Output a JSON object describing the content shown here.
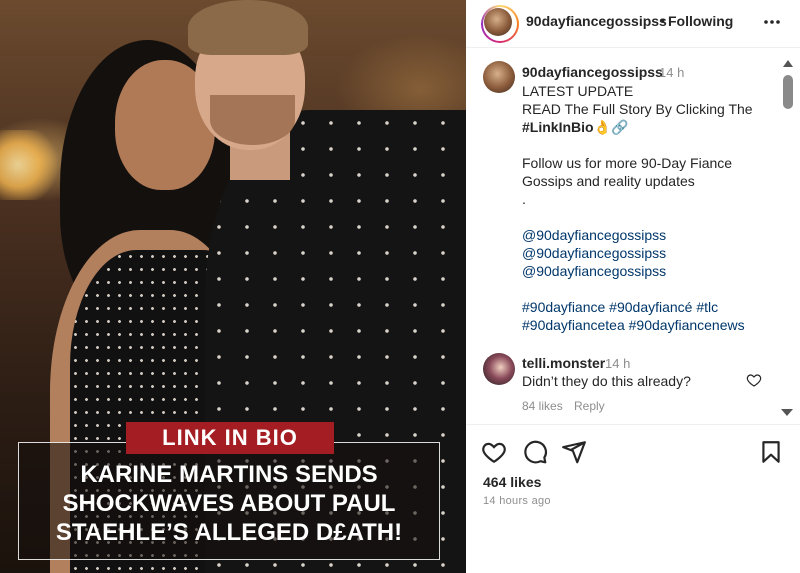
{
  "post_image": {
    "tag_label": "LINK IN BIO",
    "headline": "KARINE MARTINS SENDS SHOCKWAVES ABOUT PAUL STAEHLE’S ALLEGED D£ATH!"
  },
  "header": {
    "username": "90dayfiancegossipss",
    "separator": "•",
    "follow_status": "Following",
    "more_icon": "more-horizontal-icon"
  },
  "caption": {
    "username": "90dayfiancegossipss",
    "time": "14 h",
    "lines": [
      "LATEST UPDATE",
      "READ The Full Story By Clicking The",
      "#LinkInBio👌🔗",
      "",
      "Follow us for more 90-Day Fiance",
      "Gossips and reality updates",
      ".",
      "",
      "@90dayfiancegossipss",
      "@90dayfiancegossipss",
      "@90dayfiancegossipss",
      "",
      "#90dayfiance #90dayfiancé #tlc",
      "#90dayfiancetea #90dayfiancenews"
    ]
  },
  "comment": {
    "username": "telli.monster",
    "time": "14 h",
    "text": "Didn’t they do this already?",
    "likes": "84 likes",
    "reply_label": "Reply"
  },
  "actions": {
    "icons": [
      "heart-icon",
      "comment-icon",
      "share-icon",
      "bookmark-icon"
    ],
    "likes": "464 likes",
    "posted": "14 hours ago"
  },
  "colors": {
    "tag_bg": "#a31d22",
    "link": "#00376b",
    "muted": "#8e8e8e"
  }
}
